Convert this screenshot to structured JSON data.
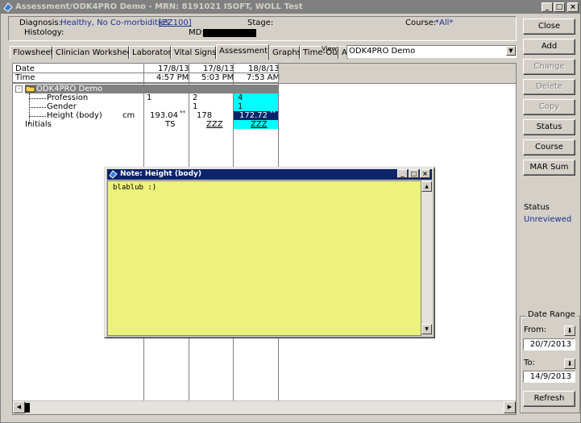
{
  "window": {
    "title": "Assessment/ODK4PRO Demo - MRN: 8191021  ISOFT, WOLL Test",
    "minimize": "_",
    "maximize": "□",
    "close": "×"
  },
  "header": {
    "diagnosis_label": "Diagnosis:",
    "diagnosis_value": "Healthy, No Co-morbidities",
    "diagnosis_code": "[ZZ100]",
    "stage_label": "Stage:",
    "course_label": "Course:",
    "course_value": "*All*",
    "histology_label": "Histology:",
    "md_label": "MD:"
  },
  "tabs": [
    {
      "label": "Flowsheet"
    },
    {
      "label": "Clinician Worksheet"
    },
    {
      "label": "Laboratory"
    },
    {
      "label": "Vital Signs"
    },
    {
      "label": "Assessment"
    },
    {
      "label": "Graphs"
    },
    {
      "label": "Time-Out"
    },
    {
      "label": "A"
    }
  ],
  "view": {
    "label": "View",
    "value": "ODK4PRO Demo"
  },
  "grid": {
    "date_label": "Date",
    "time_label": "Time",
    "columns": [
      {
        "date": "17/8/13",
        "time": "4:57 PM"
      },
      {
        "date": "17/8/13",
        "time": "5:03 PM"
      },
      {
        "date": "18/8/13",
        "time": "7:53 AM"
      }
    ],
    "group": "ODK4PRO Demo",
    "rows": [
      {
        "label": "Profession",
        "unit": "",
        "values": [
          "1",
          "2",
          "4"
        ]
      },
      {
        "label": "Gender",
        "unit": "",
        "values": [
          "",
          "1",
          "1"
        ]
      },
      {
        "label": "Height (body)",
        "unit": "cm",
        "values": [
          "193.04",
          "178",
          "172.72"
        ],
        "notes": [
          "**",
          "",
          "**"
        ]
      },
      {
        "label": "Initials",
        "unit": "",
        "values": [
          "TS",
          "ZZZ",
          "ZZZ"
        ]
      }
    ]
  },
  "buttons": {
    "close": "Close",
    "add": "Add",
    "change": "Change",
    "delete": "Delete",
    "copy": "Copy",
    "status": "Status",
    "course": "Course",
    "mar_sum": "MAR Sum"
  },
  "status": {
    "label": "Status",
    "value": "Unreviewed"
  },
  "date_range": {
    "title": "Date Range",
    "from_label": "From:",
    "from_value": "20/7/2013",
    "to_label": "To:",
    "to_value": "14/9/2013",
    "refresh": "Refresh"
  },
  "note": {
    "title": "Note: Height (body)",
    "text": "blablub :)"
  },
  "colors": {
    "title_bar": "#808080",
    "note_title_bar": "#0a246a",
    "note_bg": "#ecf27a",
    "selected_row_bg": "#0a246a",
    "highlight_bg": "#00ffff",
    "link_blue": "#1c2e8c",
    "group_row_bg": "#808080"
  }
}
